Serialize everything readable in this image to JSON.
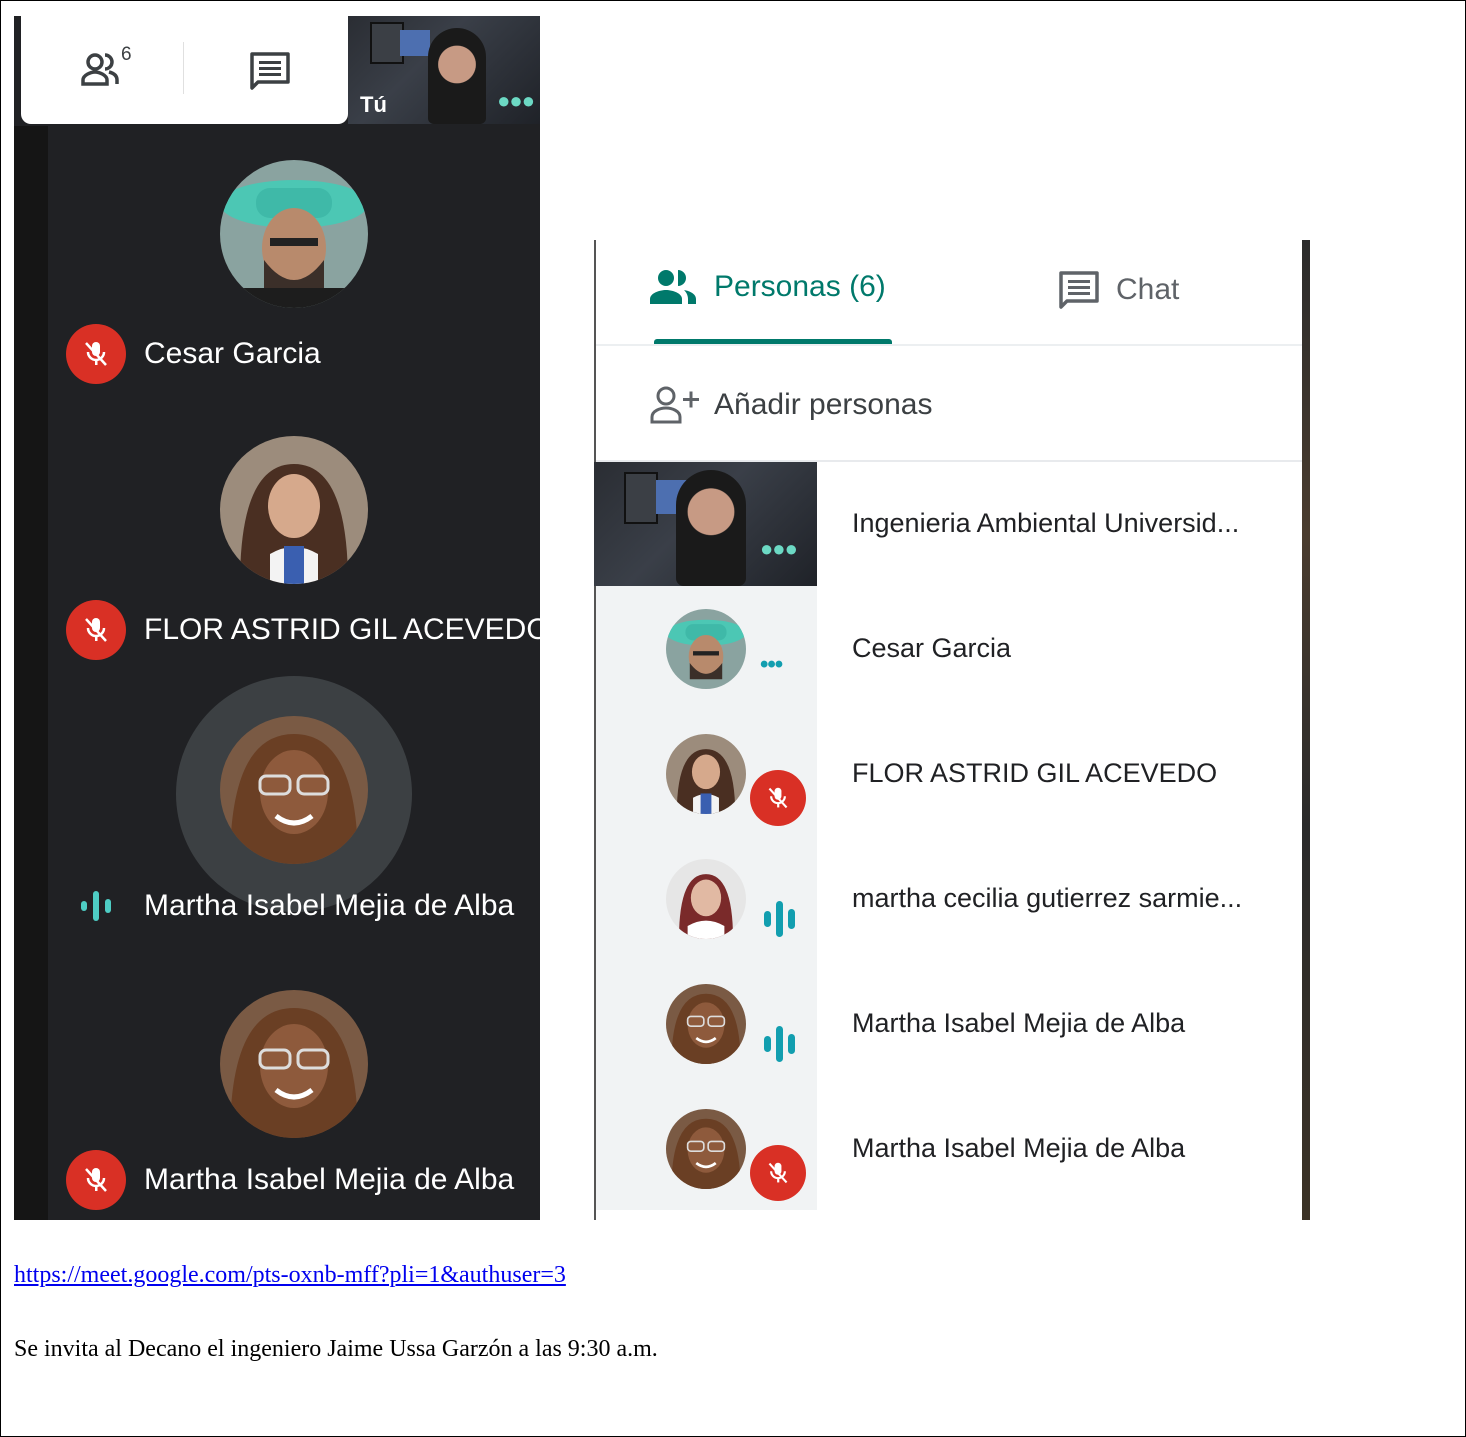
{
  "left_panel": {
    "participants_count": "6",
    "self_label": "Tú",
    "tiles": [
      {
        "name": "Cesar Garcia",
        "status": "muted"
      },
      {
        "name": "FLOR ASTRID GIL ACEVEDO",
        "status": "muted"
      },
      {
        "name": "Martha Isabel Mejia de Alba",
        "status": "speaking"
      },
      {
        "name": "Martha Isabel Mejia de Alba",
        "status": "muted"
      }
    ]
  },
  "right_panel": {
    "tab_people": "Personas (6)",
    "tab_chat": "Chat",
    "add_people": "Añadir personas",
    "participants": [
      {
        "name": "Ingenieria Ambiental Universid...",
        "status": "self"
      },
      {
        "name": "Cesar Garcia",
        "status": "more"
      },
      {
        "name": "FLOR ASTRID GIL ACEVEDO",
        "status": "muted"
      },
      {
        "name": "martha cecilia gutierrez sarmie...",
        "status": "speaking"
      },
      {
        "name": "Martha Isabel Mejia de Alba",
        "status": "speaking"
      },
      {
        "name": "Martha Isabel Mejia de Alba",
        "status": "muted"
      }
    ]
  },
  "doc": {
    "link": "https://meet.google.com/pts-oxnb-mff?pli=1&authuser=3",
    "note": "Se invita al Decano el ingeniero Jaime Ussa Garzón a las 9:30 a.m."
  },
  "colors": {
    "accent": "#00796b",
    "muted_red": "#d93025",
    "speaking_teal": "#129eaf",
    "dark_bg": "#202124"
  }
}
